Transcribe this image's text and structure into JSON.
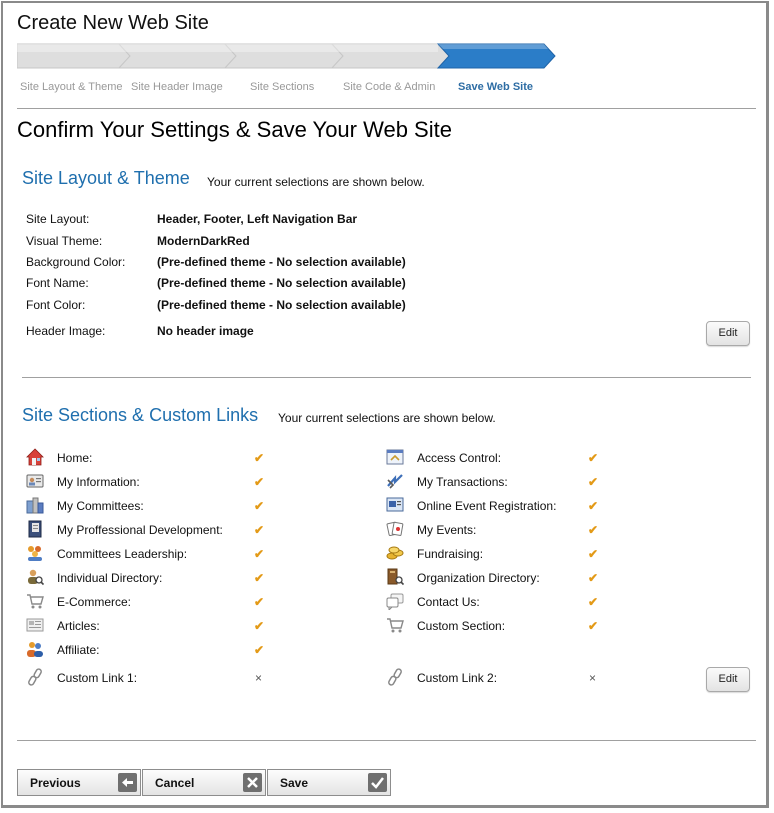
{
  "page": {
    "title": "Create New Web Site",
    "heading": "Confirm Your Settings & Save Your Web Site"
  },
  "wizard": {
    "active_index": 4,
    "colors": {
      "inactive": "#dcdcdc",
      "active": "#2b7dc8"
    },
    "steps": [
      {
        "label": "Site Layout & Theme"
      },
      {
        "label": "Site Header Image"
      },
      {
        "label": "Site Sections"
      },
      {
        "label": "Site Code & Admin"
      },
      {
        "label": "Save Web Site"
      }
    ]
  },
  "layout_section": {
    "title": "Site Layout & Theme",
    "note": "Your current selections are shown below.",
    "rows": [
      {
        "label": "Site Layout:",
        "value": "Header, Footer, Left Navigation Bar"
      },
      {
        "label": "Visual Theme:",
        "value": "ModernDarkRed"
      },
      {
        "label": "Background Color:",
        "value": "(Pre-defined theme - No selection available)"
      },
      {
        "label": "Font Name:",
        "value": "(Pre-defined theme - No selection available)"
      },
      {
        "label": "Font Color:",
        "value": "(Pre-defined theme - No selection available)"
      },
      {
        "label": "Header Image:",
        "value": "No header image"
      }
    ],
    "edit_label": "Edit"
  },
  "sections_section": {
    "title": "Site Sections & Custom Links",
    "note": "Your current selections are shown below.",
    "check_symbol": "✔",
    "x_symbol": "×",
    "left": [
      {
        "label": "Home:",
        "icon": "home-icon",
        "status": "check"
      },
      {
        "label": "My Information:",
        "icon": "id-card-icon",
        "status": "check"
      },
      {
        "label": "My Committees:",
        "icon": "committees-icon",
        "status": "check"
      },
      {
        "label": "My Proffessional Development:",
        "icon": "book-icon",
        "status": "check"
      },
      {
        "label": "Committees Leadership:",
        "icon": "group-icon",
        "status": "check"
      },
      {
        "label": "Individual Directory:",
        "icon": "person-search-icon",
        "status": "check"
      },
      {
        "label": "E-Commerce:",
        "icon": "cart-icon",
        "status": "check"
      },
      {
        "label": "Articles:",
        "icon": "newspaper-icon",
        "status": "check"
      },
      {
        "label": "Affiliate:",
        "icon": "affiliate-icon",
        "status": "check"
      },
      {
        "label": "Custom Link 1:",
        "icon": "link-icon",
        "status": "x"
      }
    ],
    "right": [
      {
        "label": "Access Control:",
        "icon": "access-control-icon",
        "status": "check"
      },
      {
        "label": "My Transactions:",
        "icon": "transactions-icon",
        "status": "check"
      },
      {
        "label": "Online Event Registration:",
        "icon": "event-registration-icon",
        "status": "check"
      },
      {
        "label": "My Events:",
        "icon": "cards-icon",
        "status": "check"
      },
      {
        "label": "Fundraising:",
        "icon": "coins-icon",
        "status": "check"
      },
      {
        "label": "Organization Directory:",
        "icon": "org-search-icon",
        "status": "check"
      },
      {
        "label": "Contact Us:",
        "icon": "chat-icon",
        "status": "check"
      },
      {
        "label": "Custom Section:",
        "icon": "cart-icon",
        "status": "check"
      },
      {
        "label": "Custom Link 2:",
        "icon": "link-icon",
        "status": "x"
      }
    ],
    "edit_label": "Edit"
  },
  "footer": {
    "previous_label": "Previous",
    "cancel_label": "Cancel",
    "save_label": "Save",
    "previous_icon": "arrow-left-icon",
    "cancel_icon": "close-icon",
    "save_icon": "check-icon"
  }
}
